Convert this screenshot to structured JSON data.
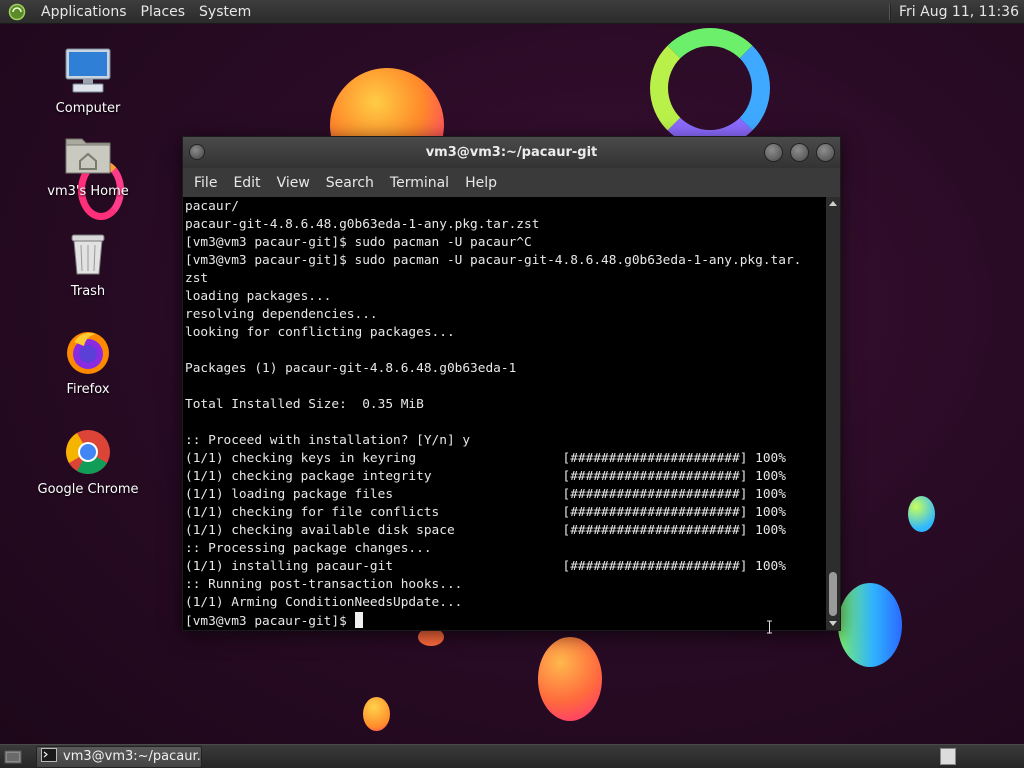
{
  "top_panel": {
    "menus": [
      "Applications",
      "Places",
      "System"
    ],
    "clock": "Fri Aug 11, 11:36"
  },
  "desktop": {
    "icons": [
      {
        "label": "Computer",
        "icon": "computer-icon"
      },
      {
        "label": "vm3's Home",
        "icon": "home-folder-icon"
      },
      {
        "label": "Trash",
        "icon": "trash-icon"
      },
      {
        "label": "Firefox",
        "icon": "firefox-icon"
      },
      {
        "label": "Google Chrome",
        "icon": "chrome-icon"
      }
    ]
  },
  "terminal": {
    "title": "vm3@vm3:~/pacaur-git",
    "menu": [
      "File",
      "Edit",
      "View",
      "Search",
      "Terminal",
      "Help"
    ],
    "lines": [
      "pacaur/",
      "pacaur-git-4.8.6.48.g0b63eda-1-any.pkg.tar.zst",
      "[vm3@vm3 pacaur-git]$ sudo pacman -U pacaur^C",
      "[vm3@vm3 pacaur-git]$ sudo pacman -U pacaur-git-4.8.6.48.g0b63eda-1-any.pkg.tar.",
      "zst",
      "loading packages...",
      "resolving dependencies...",
      "looking for conflicting packages...",
      "",
      "Packages (1) pacaur-git-4.8.6.48.g0b63eda-1",
      "",
      "Total Installed Size:  0.35 MiB",
      "",
      ":: Proceed with installation? [Y/n] y",
      "(1/1) checking keys in keyring                   [######################] 100%",
      "(1/1) checking package integrity                 [######################] 100%",
      "(1/1) loading package files                      [######################] 100%",
      "(1/1) checking for file conflicts                [######################] 100%",
      "(1/1) checking available disk space              [######################] 100%",
      ":: Processing package changes...",
      "(1/1) installing pacaur-git                      [######################] 100%",
      ":: Running post-transaction hooks...",
      "(1/1) Arming ConditionNeedsUpdate..."
    ],
    "prompt": "[vm3@vm3 pacaur-git]$ "
  },
  "taskbar": {
    "task_label": "vm3@vm3:~/pacaur..."
  }
}
